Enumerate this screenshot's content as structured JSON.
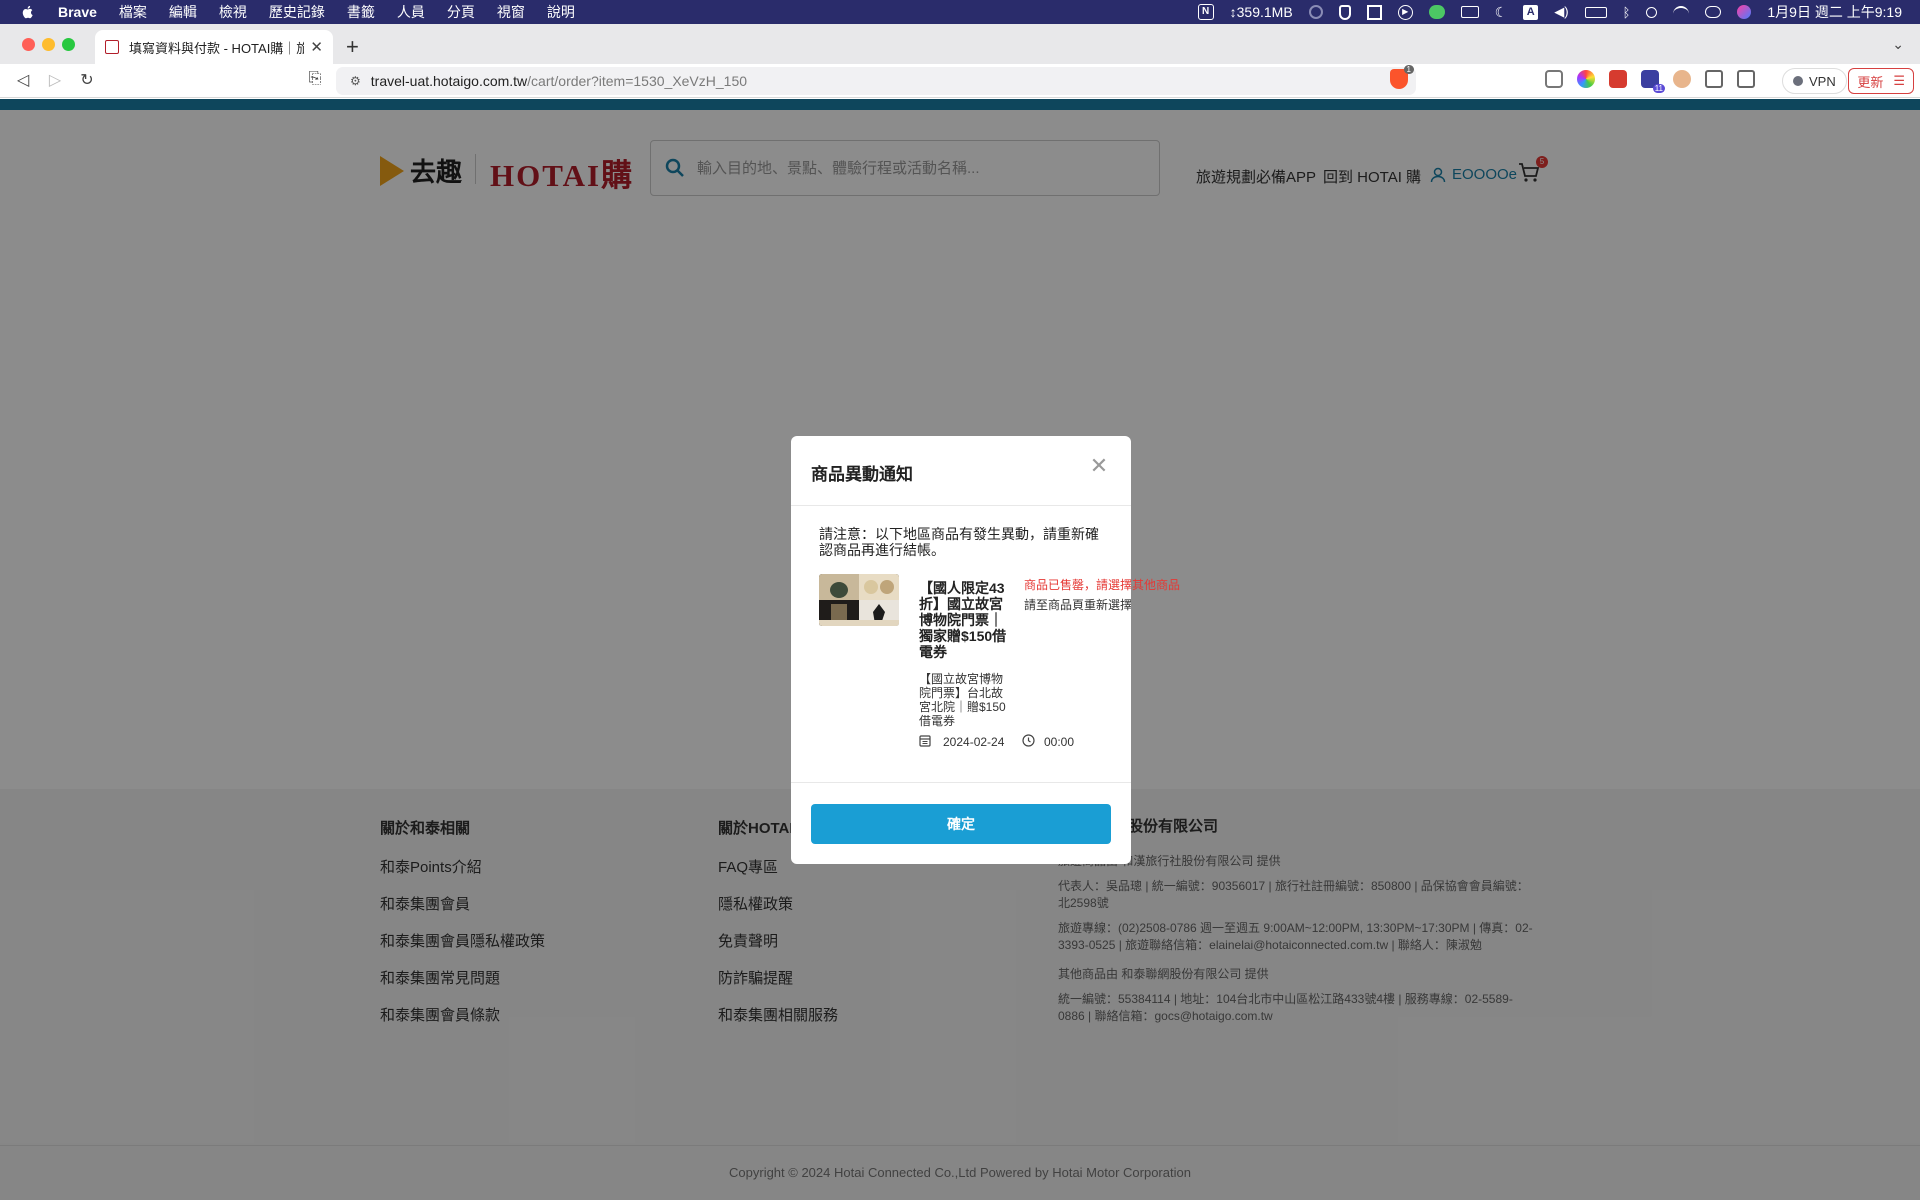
{
  "menubar": {
    "app": "Brave",
    "items": [
      "檔案",
      "編輯",
      "檢視",
      "歷史記錄",
      "書籤",
      "人員",
      "分頁",
      "視窗",
      "說明"
    ],
    "memory": "↕359.1MB",
    "clock": "1月9日 週二 上午9:19"
  },
  "browser": {
    "tab_title": "填寫資料與付款 - HOTAI購｜旅遊",
    "url_host": "travel-uat.hotaigo.com.tw",
    "url_path": "/cart/order?item=1530_XeVzH_150",
    "vpn_label": "VPN",
    "update_label": "更新",
    "shield_count": "1",
    "ext_badge": "11"
  },
  "header": {
    "brand_qq": "去趣",
    "brand_hotai": "HOTAI購",
    "search_placeholder": "輸入目的地、景點、體驗行程或活動名稱...",
    "link_app": "旅遊規劃必備APP",
    "link_hotai": "回到 HOTAI 購",
    "user": "EOOOOe",
    "cart_count": "5"
  },
  "footer": {
    "col1": {
      "title": "關於和泰相關",
      "links": [
        "和泰Points介紹",
        "和泰集團會員",
        "和泰集團會員隱私權政策",
        "和泰集團常見問題",
        "和泰集團會員條款"
      ]
    },
    "col2": {
      "title": "關於HOTAI",
      "links": [
        "FAQ專區",
        "隱私權政策",
        "免責聲明",
        "防詐騙提醒",
        "和泰集團相關服務"
      ]
    },
    "col3": {
      "title": "股份有限公司",
      "provider1": "旅遊商品由 和漢旅行社股份有限公司 提供",
      "info1": "代表人：吳品璁 | 統一編號：90356017 | 旅行社註冊編號：850800 | 品保協會會員編號：北2598號",
      "info2": "旅遊專線：(02)2508-0786 週一至週五 9:00AM~12:00PM, 13:30PM~17:30PM | 傳真：02-3393-0525 | 旅遊聯絡信箱：elainelai@hotaiconnected.com.tw | 聯絡人：陳淑勉",
      "provider2": "其他商品由 和泰聯網股份有限公司 提供",
      "info3": "統一編號：55384114 | 地址：104台北市中山區松江路433號4樓 | 服務專線：02-5589-0886 | 聯絡信箱：gocs@hotaigo.com.tw"
    },
    "copyright": "Copyright © 2024 Hotai Connected Co.,Ltd Powered by Hotai Motor Corporation"
  },
  "modal": {
    "title": "商品異動通知",
    "notice": "請注意：以下地區商品有發生異動，請重新確認商品再進行結帳。",
    "product_name": "【國人限定43折】國立故宮博物院門票｜獨家贈$150借電券",
    "status": "商品已售罄，請選擇其他商品",
    "status_hint": "請至商品頁重新選擇",
    "product_sub": "【國立故宮博物院門票】台北故宮北院｜贈$150借電券",
    "date": "2024-02-24",
    "time": "00:00",
    "confirm_label": "確定"
  },
  "colors": {
    "accent": "#1a9ed4",
    "brand_red": "#b21e2a",
    "topbar": "#1a80a8",
    "alert_red": "#e53935"
  }
}
